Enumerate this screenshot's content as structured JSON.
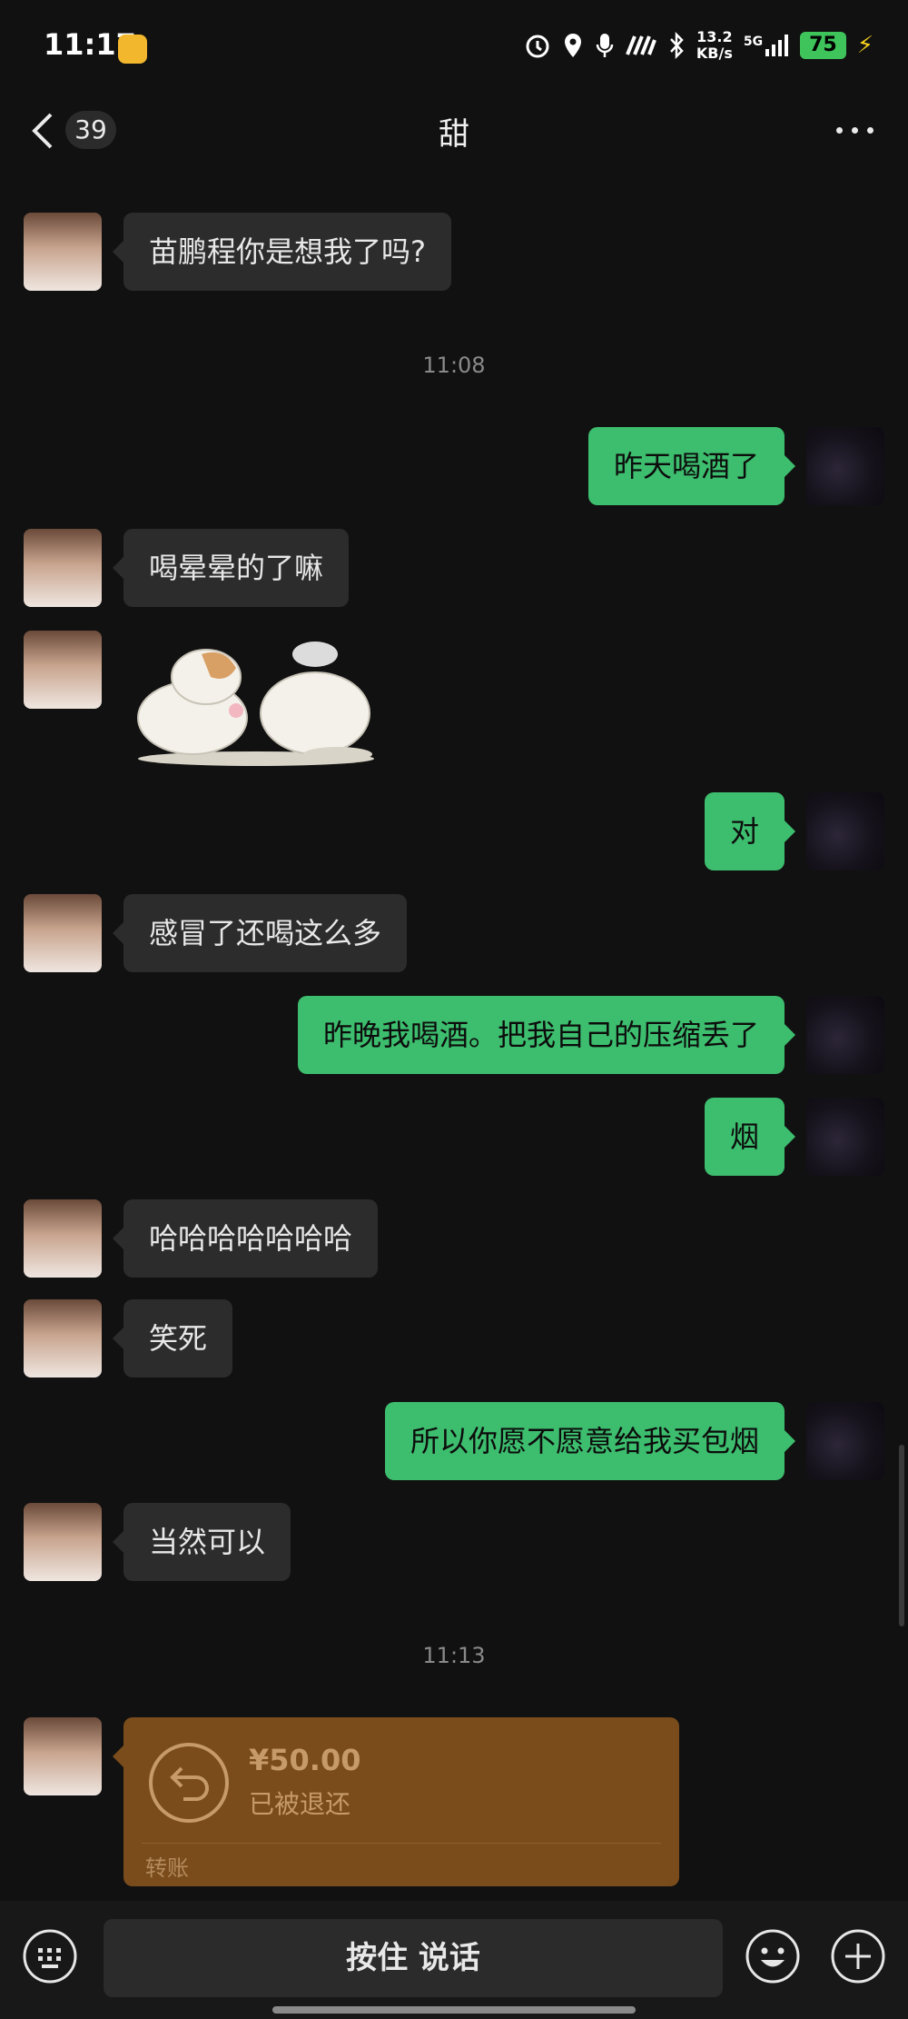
{
  "status_bar": {
    "time": "11:17",
    "speed_value": "13.2",
    "speed_unit": "KB/s",
    "network": "5G",
    "battery": "75"
  },
  "header": {
    "back_badge": "39",
    "title": "甜"
  },
  "messages": [
    {
      "side": "left",
      "text": "苗鹏程你是想我了吗?"
    },
    {
      "type": "time",
      "text": "11:08"
    },
    {
      "side": "right",
      "text": "昨天喝酒了"
    },
    {
      "side": "left",
      "text": "喝晕晕的了嘛"
    },
    {
      "side": "left",
      "type": "sticker",
      "sticker": "hamster-sticker"
    },
    {
      "side": "right",
      "text": "对"
    },
    {
      "side": "left",
      "text": "感冒了还喝这么多"
    },
    {
      "side": "right",
      "text": "昨晚我喝酒。把我自己的压缩丢了"
    },
    {
      "side": "right",
      "text": "烟"
    },
    {
      "side": "left",
      "text": "哈哈哈哈哈哈哈"
    },
    {
      "side": "left",
      "text": "笑死"
    },
    {
      "side": "right",
      "text": "所以你愿不愿意给我买包烟"
    },
    {
      "side": "left",
      "text": "当然可以"
    },
    {
      "type": "time",
      "text": "11:13"
    }
  ],
  "transfer": {
    "amount": "¥50.00",
    "status": "已被退还",
    "label": "转账"
  },
  "input_bar": {
    "talk_label": "按住 说话"
  },
  "colors": {
    "background": "#111111",
    "my_bubble": "#3dbd6e",
    "their_bubble": "#2c2c2c",
    "transfer_card": "#7a4c1c"
  }
}
